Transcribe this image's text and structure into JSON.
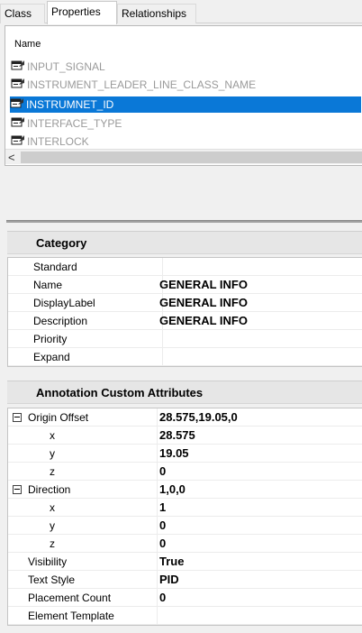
{
  "tabs": [
    "Class",
    "Properties",
    "Relationships"
  ],
  "active_tab": "Properties",
  "list": {
    "header": "Name",
    "items": [
      {
        "label": "INPUT_SIGNAL",
        "icon": "property-icon",
        "selected": false
      },
      {
        "label": "INSTRUMENT_LEADER_LINE_CLASS_NAME",
        "icon": "property-icon",
        "selected": false
      },
      {
        "label": "INSTRUMNET_ID",
        "icon": "property-icon",
        "selected": true
      },
      {
        "label": "INTERFACE_TYPE",
        "icon": "property-icon",
        "selected": false
      },
      {
        "label": "INTERLOCK",
        "icon": "property-icon",
        "selected": false
      }
    ],
    "scroll_left_glyph": "<"
  },
  "category": {
    "title": "Category",
    "rows": [
      {
        "name": "Standard",
        "value": ""
      },
      {
        "name": "Name",
        "value": "GENERAL INFO"
      },
      {
        "name": "DisplayLabel",
        "value": "GENERAL INFO"
      },
      {
        "name": "Description",
        "value": "GENERAL INFO"
      },
      {
        "name": "Priority",
        "value": ""
      },
      {
        "name": "Expand",
        "value": ""
      }
    ]
  },
  "annotation": {
    "title": "Annotation Custom Attributes",
    "rows": [
      {
        "name": "Origin Offset",
        "value": "28.575,19.05,0",
        "expander": true,
        "sub": false
      },
      {
        "name": "x",
        "value": "28.575",
        "expander": false,
        "sub": true
      },
      {
        "name": "y",
        "value": "19.05",
        "expander": false,
        "sub": true
      },
      {
        "name": "z",
        "value": "0",
        "expander": false,
        "sub": true
      },
      {
        "name": "Direction",
        "value": "1,0,0",
        "expander": true,
        "sub": false
      },
      {
        "name": "x",
        "value": "1",
        "expander": false,
        "sub": true
      },
      {
        "name": "y",
        "value": "0",
        "expander": false,
        "sub": true
      },
      {
        "name": "z",
        "value": "0",
        "expander": false,
        "sub": true
      },
      {
        "name": "Visibility",
        "value": "True",
        "expander": false,
        "sub": false
      },
      {
        "name": "Text Style",
        "value": "PID",
        "expander": false,
        "sub": false
      },
      {
        "name": "Placement Count",
        "value": "0",
        "expander": false,
        "sub": false
      },
      {
        "name": "Element Template",
        "value": "",
        "expander": false,
        "sub": false
      }
    ]
  },
  "colors": {
    "selection": "#0a78d7",
    "inactive_text": "#9a9a9a"
  }
}
